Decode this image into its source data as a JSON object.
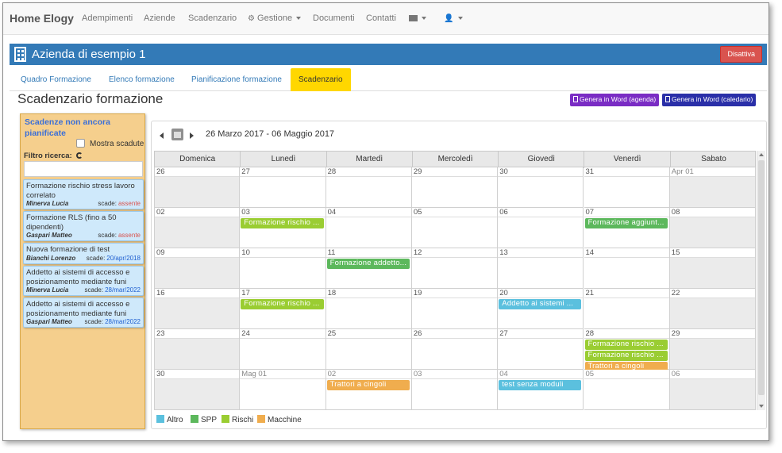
{
  "navbar": {
    "brand": "Home Elogy",
    "items": [
      "Adempimenti",
      "Aziende",
      "Scadenzario",
      "Gestione",
      "Documenti",
      "Contatti"
    ]
  },
  "company": {
    "title": "Azienda di esempio 1",
    "deactivate_label": "Disattiva"
  },
  "tabs": [
    "Quadro Formazione",
    "Elenco formazione",
    "Pianificazione formazione",
    "Scadenzario"
  ],
  "page_title": "Scadenzario formazione",
  "buttons": {
    "word_agenda": "Genera in Word (agenda)",
    "word_calendar": "Genera in Word (caledario)"
  },
  "sidebar": {
    "title": "Scadenze non ancora pianificate",
    "show_expired": "Mostra scadute",
    "filter_label": "Filtro ricerca:",
    "items": [
      {
        "name": "Formazione rischio stress lavoro correlato",
        "person": "Minerva Lucia",
        "due_label": "scade:",
        "due": "assente"
      },
      {
        "name": "Formazione RLS (fino a 50 dipendenti)",
        "person": "Gaspari Matteo",
        "due_label": "scade:",
        "due": "assente"
      },
      {
        "name": "Nuova formazione di test",
        "person": "Bianchi Lorenzo",
        "due_label": "scade:",
        "due": "20/apr/2018"
      },
      {
        "name": "Addetto ai sistemi di accesso e posizionamento mediante funi",
        "person": "Minerva Lucia",
        "due_label": "scade:",
        "due": "28/mar/2022"
      },
      {
        "name": "Addetto ai sistemi di accesso e posizionamento mediante funi",
        "person": "Gaspari Matteo",
        "due_label": "scade:",
        "due": "28/mar/2022"
      }
    ]
  },
  "calendar": {
    "range": "26 Marzo 2017 - 06 Maggio 2017",
    "days_of_week": [
      "Domenica",
      "Lunedì",
      "Martedì",
      "Mercoledì",
      "Giovedì",
      "Venerdì",
      "Sabato"
    ],
    "weeks": [
      [
        {
          "n": "26"
        },
        {
          "n": "27"
        },
        {
          "n": "28"
        },
        {
          "n": "29"
        },
        {
          "n": "30"
        },
        {
          "n": "31"
        },
        {
          "n": "Apr 01"
        }
      ],
      [
        {
          "n": "02"
        },
        {
          "n": "03",
          "events": [
            {
              "label": "Formazione rischio ...",
              "cat": "Rischi"
            }
          ]
        },
        {
          "n": "04"
        },
        {
          "n": "05"
        },
        {
          "n": "06"
        },
        {
          "n": "07",
          "events": [
            {
              "label": "Formazione aggiunt...",
              "cat": "SPP"
            }
          ]
        },
        {
          "n": "08"
        }
      ],
      [
        {
          "n": "09"
        },
        {
          "n": "10"
        },
        {
          "n": "11",
          "events": [
            {
              "label": "Formazione addetto...",
              "cat": "SPP"
            }
          ]
        },
        {
          "n": "12"
        },
        {
          "n": "13"
        },
        {
          "n": "14"
        },
        {
          "n": "15"
        }
      ],
      [
        {
          "n": "16"
        },
        {
          "n": "17",
          "events": [
            {
              "label": "Formazione rischio ...",
              "cat": "Rischi"
            }
          ]
        },
        {
          "n": "18"
        },
        {
          "n": "19"
        },
        {
          "n": "20",
          "events": [
            {
              "label": "Addetto ai sistemi ...",
              "cat": "Altro"
            }
          ]
        },
        {
          "n": "21"
        },
        {
          "n": "22"
        }
      ],
      [
        {
          "n": "23"
        },
        {
          "n": "24"
        },
        {
          "n": "25"
        },
        {
          "n": "26"
        },
        {
          "n": "27"
        },
        {
          "n": "28",
          "events": [
            {
              "label": "Formazione rischio ...",
              "cat": "Rischi"
            },
            {
              "label": "Formazione rischio ...",
              "cat": "Rischi"
            },
            {
              "label": "Trattori a cingoli",
              "cat": "Macchine"
            }
          ]
        },
        {
          "n": "29"
        }
      ],
      [
        {
          "n": "30"
        },
        {
          "n": "Mag 01"
        },
        {
          "n": "02",
          "events": [
            {
              "label": "Trattori a cingoli",
              "cat": "Macchine"
            }
          ]
        },
        {
          "n": "03"
        },
        {
          "n": "04",
          "events": [
            {
              "label": "test senza moduli",
              "cat": "Altro"
            }
          ]
        },
        {
          "n": "05"
        },
        {
          "n": "06"
        }
      ]
    ]
  },
  "legend": [
    {
      "label": "Altro",
      "color": "#5bc0de"
    },
    {
      "label": "SPP",
      "color": "#5cb85c"
    },
    {
      "label": "Rischi",
      "color": "#9acd32"
    },
    {
      "label": "Macchine",
      "color": "#f0ad4e"
    }
  ],
  "colors": {
    "primary": "#337ab7",
    "danger": "#d9534f",
    "active_tab": "#ffd700",
    "word_agenda": "#7a2cc4",
    "word_calendar": "#2a2fa8",
    "due_missing": "#d9534f",
    "due_date": "#1f5fd0"
  }
}
